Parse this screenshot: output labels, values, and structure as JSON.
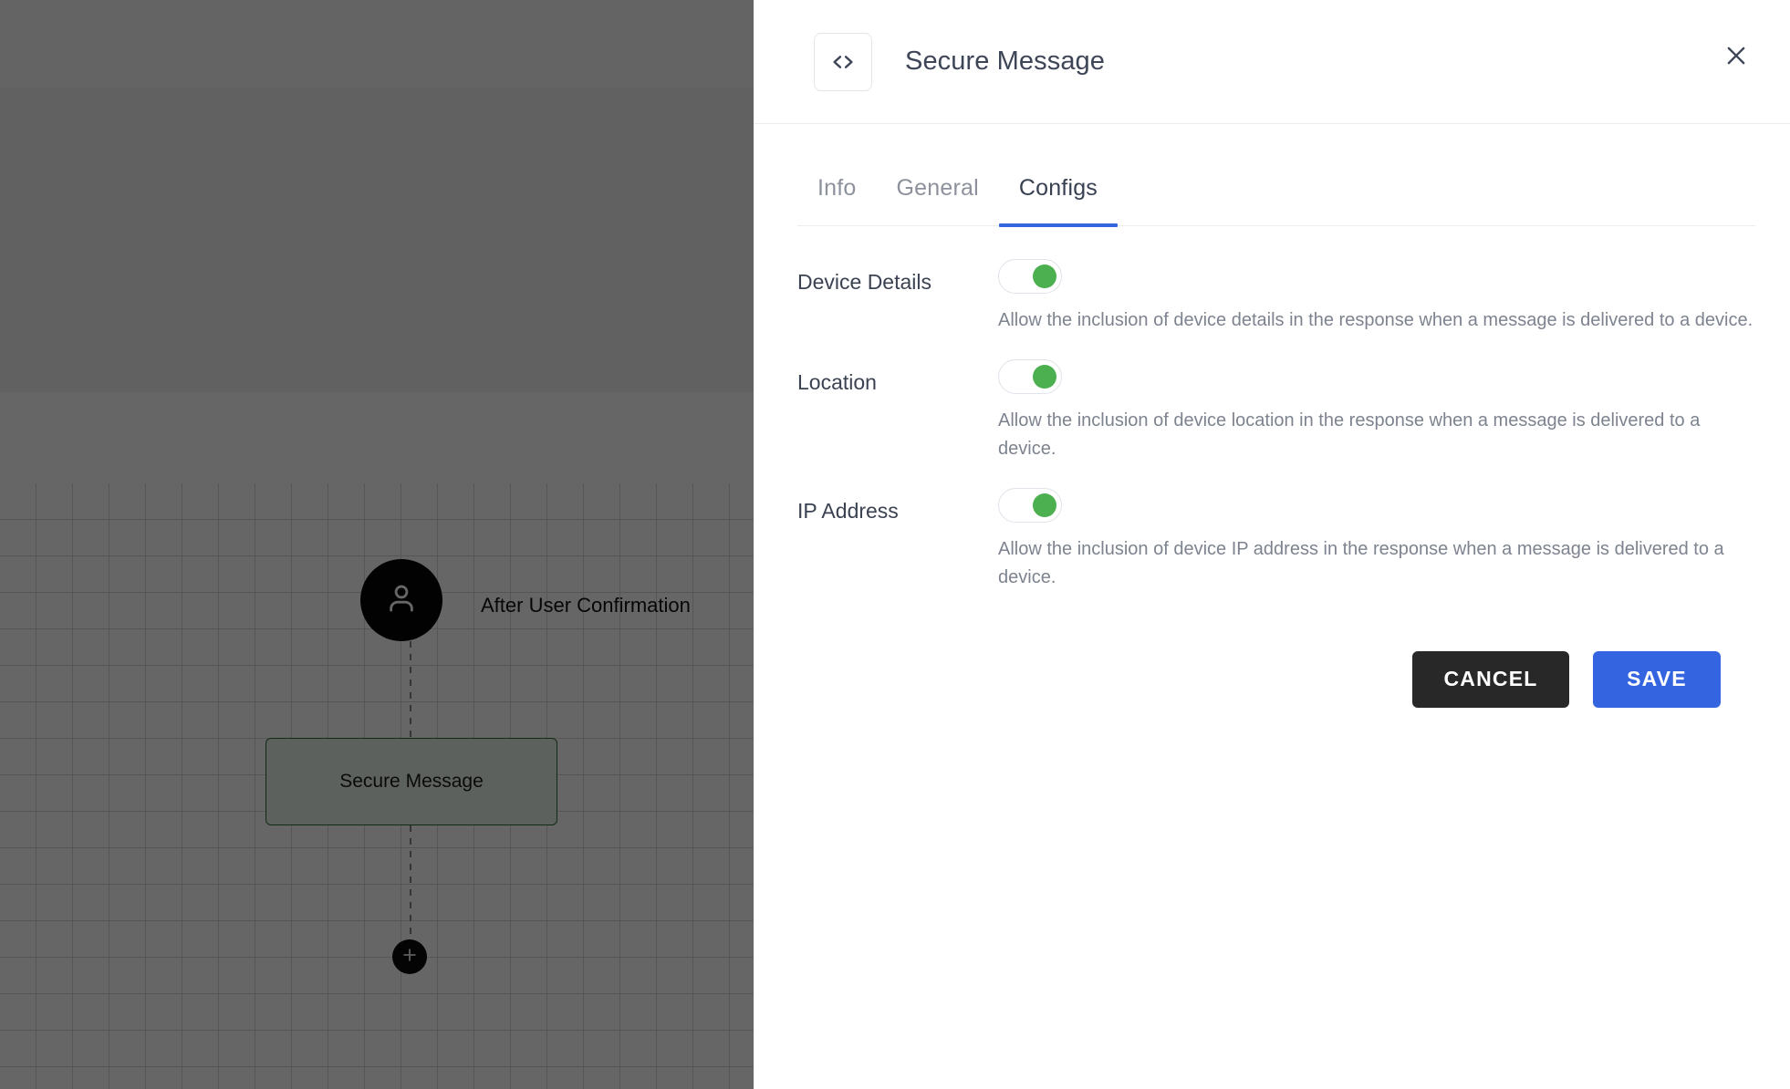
{
  "canvas": {
    "start_node": {
      "icon": "user-icon",
      "label": "After User Confirmation"
    },
    "flow_node": {
      "label": "Secure Message"
    },
    "add_node": {
      "icon": "plus-icon"
    }
  },
  "panel": {
    "header": {
      "icon": "code-brackets-icon",
      "title": "Secure Message",
      "close_icon": "close-icon"
    },
    "tabs": [
      {
        "label": "Info",
        "active": false
      },
      {
        "label": "General",
        "active": false
      },
      {
        "label": "Configs",
        "active": true
      }
    ],
    "configs": [
      {
        "label": "Device Details",
        "toggle_state": "on",
        "description": "Allow the inclusion of device details in the response when a message is delivered to a device."
      },
      {
        "label": "Location",
        "toggle_state": "on",
        "description": "Allow the inclusion of device location in the response when a message is delivered to a device."
      },
      {
        "label": "IP Address",
        "toggle_state": "on",
        "description": "Allow the inclusion of device IP address in the response when a message is delivered to a device."
      }
    ],
    "actions": {
      "cancel_label": "CANCEL",
      "save_label": "SAVE"
    }
  },
  "colors": {
    "accent_blue": "#3464e0",
    "toggle_on_green": "#4caf50",
    "cancel_dark": "#282828",
    "node_border_green": "#2f6b35",
    "title_text": "#3d4557",
    "muted_text": "#7d838f"
  }
}
